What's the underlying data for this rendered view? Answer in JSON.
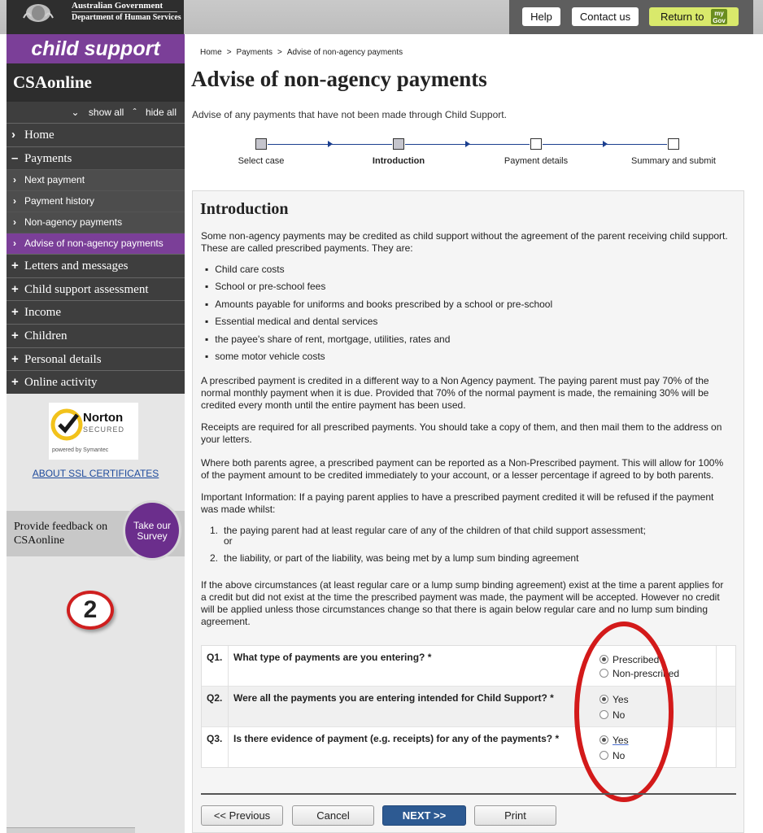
{
  "header": {
    "gov_line1": "Australian Government",
    "gov_line2": "Department of Human Services",
    "help_label": "Help",
    "contact_label": "Contact us",
    "return_label": "Return to",
    "mygov_icon_text": "my Gov"
  },
  "sidebar": {
    "brand": "child support",
    "app_title": "CSAonline",
    "show_all": "show all",
    "hide_all": "hide all",
    "items": [
      {
        "mark": "›",
        "label": "Home"
      },
      {
        "mark": "–",
        "label": "Payments"
      },
      {
        "mark": "›",
        "label": "Next payment",
        "sub": true
      },
      {
        "mark": "›",
        "label": "Payment history",
        "sub": true
      },
      {
        "mark": "›",
        "label": "Non-agency payments",
        "sub": true
      },
      {
        "mark": "›",
        "label": "Advise of non-agency payments",
        "sub": true,
        "active": true
      },
      {
        "mark": "+",
        "label": "Letters and messages"
      },
      {
        "mark": "+",
        "label": "Child support assessment"
      },
      {
        "mark": "+",
        "label": "Income"
      },
      {
        "mark": "+",
        "label": "Children"
      },
      {
        "mark": "+",
        "label": "Personal details"
      },
      {
        "mark": "+",
        "label": "Online activity"
      }
    ],
    "norton_name": "Norton",
    "norton_secured": "SECURED",
    "norton_powered": "powered by Symantec",
    "ssl_link": "ABOUT SSL CERTIFICATES",
    "feedback_text": "Provide feedback on CSAonline",
    "survey_label": "Take our Survey",
    "annotation_number": "2"
  },
  "breadcrumb": [
    "Home",
    "Payments",
    "Advise of non-agency payments"
  ],
  "breadcrumb_sep": ">",
  "page_title": "Advise of non-agency payments",
  "subtitle": "Advise of any payments that have not been made through Child Support.",
  "steps": [
    {
      "label": "Select case",
      "done": true
    },
    {
      "label": "Introduction",
      "done": true,
      "current": true
    },
    {
      "label": "Payment details",
      "done": false
    },
    {
      "label": "Summary and submit",
      "done": false
    }
  ],
  "intro": {
    "heading": "Introduction",
    "p1": "Some non-agency payments may be credited as child support without the agreement of the parent receiving child support. These are called prescribed payments. They are:",
    "bullets": [
      "Child care costs",
      "School or pre-school fees",
      "Amounts payable for uniforms and books prescribed by a school or pre-school",
      "Essential medical and dental services",
      "the payee's share of rent, mortgage, utilities, rates and",
      "some motor vehicle costs"
    ],
    "p2": "A prescribed payment is credited in a different way to a Non Agency payment. The paying parent must pay 70% of the normal monthly payment when it is due. Provided that 70% of the normal payment is made, the remaining 30% will be credited every month until the entire payment has been used.",
    "p3": "Receipts are required for all prescribed payments. You should take a copy of them, and then mail them to the address on your letters.",
    "p4": "Where both parents agree, a prescribed payment can be reported as a Non-Prescribed payment. This will allow for 100% of the payment amount to be credited immediately to your account, or a lesser percentage if agreed to by both parents.",
    "p5": "Important Information: If a paying parent applies to have a prescribed payment credited it will be refused if the payment was made whilst:",
    "list": [
      {
        "num": "1.",
        "text": "the paying parent had at least regular care of any of the children of that child support assessment;",
        "extra": "or"
      },
      {
        "num": "2.",
        "text": "the liability, or part of the liability, was being met by a lump sum binding agreement",
        "extra": ""
      }
    ],
    "p6": "If the above circumstances (at least regular care or a lump sump binding agreement) exist at the time a parent applies for a credit but did not exist at the time the prescribed payment was made, the payment will be accepted. However no credit will be applied unless those circumstances change so that there is again below regular care and no lump sum binding agreement."
  },
  "questions": [
    {
      "num": "Q1.",
      "text": "What type of payments are you entering? *",
      "options": [
        "Prescribed",
        "Non-prescribed"
      ],
      "selected": 0
    },
    {
      "num": "Q2.",
      "text": "Were all the payments you are entering intended for Child Support? *",
      "options": [
        "Yes",
        "No"
      ],
      "selected": 0
    },
    {
      "num": "Q3.",
      "text": "Is there evidence of payment (e.g. receipts) for any of the payments? *",
      "options": [
        "Yes",
        "No"
      ],
      "selected": 0
    }
  ],
  "buttons": {
    "previous": "<< Previous",
    "cancel": "Cancel",
    "next": "NEXT >>",
    "print": "Print"
  },
  "colors": {
    "brand_purple": "#7b3f98",
    "nav_dark": "#3e3e3e",
    "next_blue": "#2d5a92",
    "mygov_green": "#d9e96b",
    "annotation_red": "#d31a1a"
  }
}
